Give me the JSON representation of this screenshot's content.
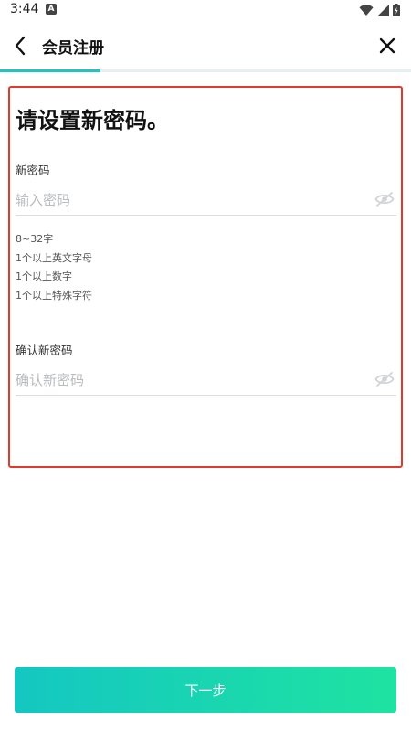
{
  "status_bar": {
    "time": "3:44",
    "notification_letter": "A"
  },
  "header": {
    "title": "会员注册",
    "back_icon": "chevron-left-icon",
    "close_icon": "close-icon"
  },
  "progress": {
    "fraction": 0.245,
    "color": "#1fc6bd"
  },
  "form": {
    "title": "请设置新密码。",
    "new_password": {
      "label": "新密码",
      "placeholder": "输入密码",
      "value": "",
      "toggle_icon": "eye-off-icon"
    },
    "rules": [
      "8~32字",
      "1个以上英文字母",
      "1个以上数字",
      "1个以上特殊字符"
    ],
    "confirm_password": {
      "label": "确认新密码",
      "placeholder": "确认新密码",
      "value": "",
      "toggle_icon": "eye-off-icon"
    }
  },
  "footer": {
    "next_label": "下一步"
  },
  "colors": {
    "accent_start": "#14c7c2",
    "accent_end": "#1ee3a1",
    "highlight_border": "#e03a2e"
  }
}
